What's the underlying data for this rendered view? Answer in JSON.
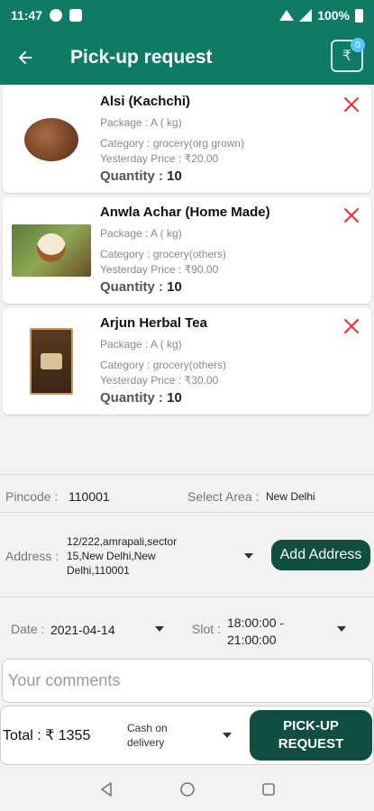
{
  "status_bar": {
    "time": "11:47",
    "battery": "100%"
  },
  "app_bar": {
    "title": "Pick-up request",
    "wallet_badge": "0",
    "wallet_symbol": "₹"
  },
  "products": [
    {
      "name": "Alsi (Kachchi)",
      "package": "Package : A ( kg)",
      "category": "Category : grocery(org grown)",
      "price": "Yesterday Price : ₹20.00",
      "quantity_label": "Quantity : ",
      "quantity": "10",
      "image": "flax-seeds"
    },
    {
      "name": "Anwla Achar (Home Made)",
      "package": "Package : A ( kg)",
      "category": "Category : grocery(others)",
      "price": "Yesterday Price : ₹90.00",
      "quantity_label": "Quantity : ",
      "quantity": "10",
      "image": "amla-pickle"
    },
    {
      "name": "Arjun Herbal Tea",
      "package": "Package : A ( kg)",
      "category": "Category : grocery(others)",
      "price": "Yesterday Price : ₹30.00",
      "quantity_label": "Quantity : ",
      "quantity": "10",
      "image": "herbal-tea-box"
    }
  ],
  "form": {
    "pincode_label": "Pincode :",
    "pincode_value": "110001",
    "area_label": "Select Area :",
    "area_value": "New Delhi",
    "address_label": "Address :",
    "address_value": "12/222,amrapali,sector 15,New Delhi,New Delhi,110001",
    "add_address_label": "Add Address",
    "date_label": "Date :",
    "date_value": "2021-04-14",
    "slot_label": "Slot :",
    "slot_value": "18:00:00 - 21:00:00",
    "comments_placeholder": "Your comments"
  },
  "footer": {
    "total_text": "Total : ₹ 1355",
    "payment_value": "Cash on delivery",
    "pickup_button": "PICK-UP REQUEST"
  },
  "colors": {
    "primary": "#0f7a66",
    "button": "#0f4e40",
    "remove": "#e53935"
  }
}
